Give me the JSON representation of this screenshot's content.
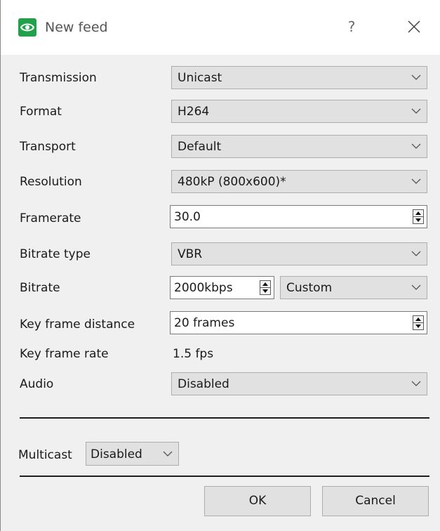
{
  "window": {
    "title": "New feed",
    "help_label": "?"
  },
  "form": {
    "transmission": {
      "label": "Transmission",
      "value": "Unicast"
    },
    "format": {
      "label": "Format",
      "value": "H264"
    },
    "transport": {
      "label": "Transport",
      "value": "Default"
    },
    "resolution": {
      "label": "Resolution",
      "value": "480kP (800x600)*"
    },
    "framerate": {
      "label": "Framerate",
      "value": "30.0"
    },
    "bitrate_type": {
      "label": "Bitrate type",
      "value": "VBR"
    },
    "bitrate": {
      "label": "Bitrate",
      "value": "2000kbps",
      "preset": "Custom"
    },
    "key_frame_distance": {
      "label": "Key frame distance",
      "value": "20 frames"
    },
    "key_frame_rate": {
      "label": "Key frame rate",
      "value": "1.5 fps"
    },
    "audio": {
      "label": "Audio",
      "value": "Disabled"
    }
  },
  "multicast": {
    "label": "Multicast",
    "value": "Disabled"
  },
  "buttons": {
    "ok": "OK",
    "cancel": "Cancel"
  },
  "icons": {
    "app": "eye-icon",
    "close": "close-icon",
    "dropdown": "chevron-down-icon",
    "spinner": "spin-up-down-icon"
  },
  "colors": {
    "app_icon_bg": "#22a04b",
    "combo_bg": "#e1e1e1",
    "dialog_bg": "#f0f0f0"
  }
}
